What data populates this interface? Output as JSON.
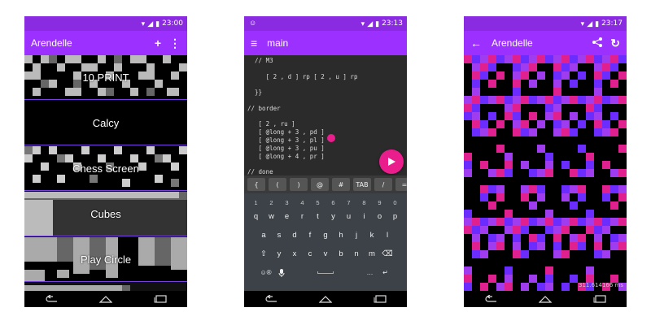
{
  "phones": [
    {
      "status_time": "23:00",
      "appbar_title": "Arendelle",
      "actions": [
        "plus-icon",
        "more-vert-icon"
      ],
      "list": [
        {
          "label": "10 PRINT"
        },
        {
          "label": "Calcy"
        },
        {
          "label": "Chess Screen"
        },
        {
          "label": "Cubes"
        },
        {
          "label": "Play Circle"
        }
      ]
    },
    {
      "status_time": "23:13",
      "appbar_title": "main",
      "code_lines": [
        "  // M3",
        "",
        "     [ 2 , d ] rp [ 2 , u ] rp",
        "",
        "  }}",
        "",
        "// border",
        "",
        "   [ 2 , ru ]",
        "   [ @long + 3 , pd ]",
        "   [ @long + 3 , pl ]",
        "   [ @long + 3 , pu ]",
        "   [ @long + 4 , pr ]",
        "",
        "// done"
      ],
      "symbol_keys": [
        "{",
        "(",
        ")",
        "@",
        "#",
        "TAB",
        "/",
        "="
      ],
      "keyboard": {
        "numbers": [
          "1",
          "2",
          "3",
          "4",
          "5",
          "6",
          "7",
          "8",
          "9",
          "0"
        ],
        "row1": [
          "q",
          "w",
          "e",
          "r",
          "t",
          "y",
          "u",
          "i",
          "o",
          "p"
        ],
        "row2": [
          "a",
          "s",
          "d",
          "f",
          "g",
          "h",
          "j",
          "k",
          "l"
        ],
        "row3": [
          "y",
          "x",
          "c",
          "v",
          "b",
          "n",
          "m"
        ],
        "bottom_left": "☺®",
        "bottom_comma": "̦",
        "bottom_period": "."
      }
    },
    {
      "status_time": "23:17",
      "appbar_title": "Arendelle",
      "timing": "311.614166 ms"
    }
  ],
  "colors": {
    "appbar": "#9b30ff",
    "statusbar": "#8a2be2",
    "accent": "#e91e8c",
    "magenta": "#e0208e",
    "violet": "#6a2cff",
    "purple": "#a03cf0"
  }
}
